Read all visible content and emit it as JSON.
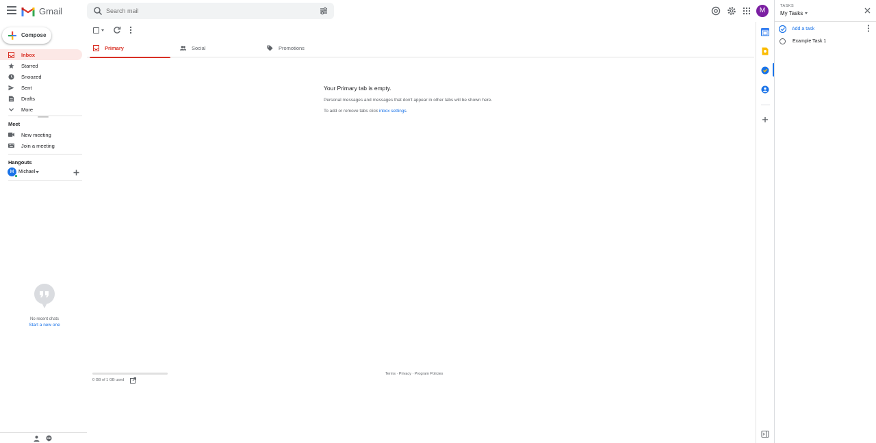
{
  "header": {
    "app_name": "Gmail",
    "search_placeholder": "Search mail",
    "avatar_initial": "M"
  },
  "sidebar": {
    "compose_label": "Compose",
    "items": [
      {
        "label": "Inbox",
        "icon": "inbox-icon",
        "active": true
      },
      {
        "label": "Starred",
        "icon": "star-icon",
        "active": false
      },
      {
        "label": "Snoozed",
        "icon": "clock-icon",
        "active": false
      },
      {
        "label": "Sent",
        "icon": "send-icon",
        "active": false
      },
      {
        "label": "Drafts",
        "icon": "draft-icon",
        "active": false
      },
      {
        "label": "More",
        "icon": "chevron-down-icon",
        "active": false
      }
    ],
    "meet": {
      "title": "Meet",
      "new_meeting": "New meeting",
      "join_meeting": "Join a meeting"
    },
    "hangouts": {
      "title": "Hangouts",
      "user_initial": "M",
      "user_name": "Michael",
      "no_chats": "No recent chats",
      "start_chat": "Start a new one"
    }
  },
  "tabs": [
    {
      "label": "Primary",
      "icon": "inbox-icon",
      "active": true
    },
    {
      "label": "Social",
      "icon": "people-icon",
      "active": false
    },
    {
      "label": "Promotions",
      "icon": "tag-icon",
      "active": false
    }
  ],
  "empty_state": {
    "title": "Your Primary tab is empty.",
    "line1": "Personal messages and messages that don't appear in other tabs will be shown here.",
    "line2_prefix": "To add or remove tabs click ",
    "line2_link": "inbox settings",
    "line2_suffix": "."
  },
  "footer": {
    "storage_text": "0 GB of 1 GB used",
    "storage_fraction": 0.0,
    "terms": "Terms",
    "privacy": "Privacy",
    "program_policies": "Program Policies",
    "sep": " · "
  },
  "tasks": {
    "header": "TASKS",
    "list_name": "My Tasks",
    "add_label": "Add a task",
    "items": [
      "Example Task 1"
    ]
  },
  "colors": {
    "accent_red": "#d93025",
    "link_blue": "#1a73e8",
    "active_bg": "#fce8e6"
  }
}
